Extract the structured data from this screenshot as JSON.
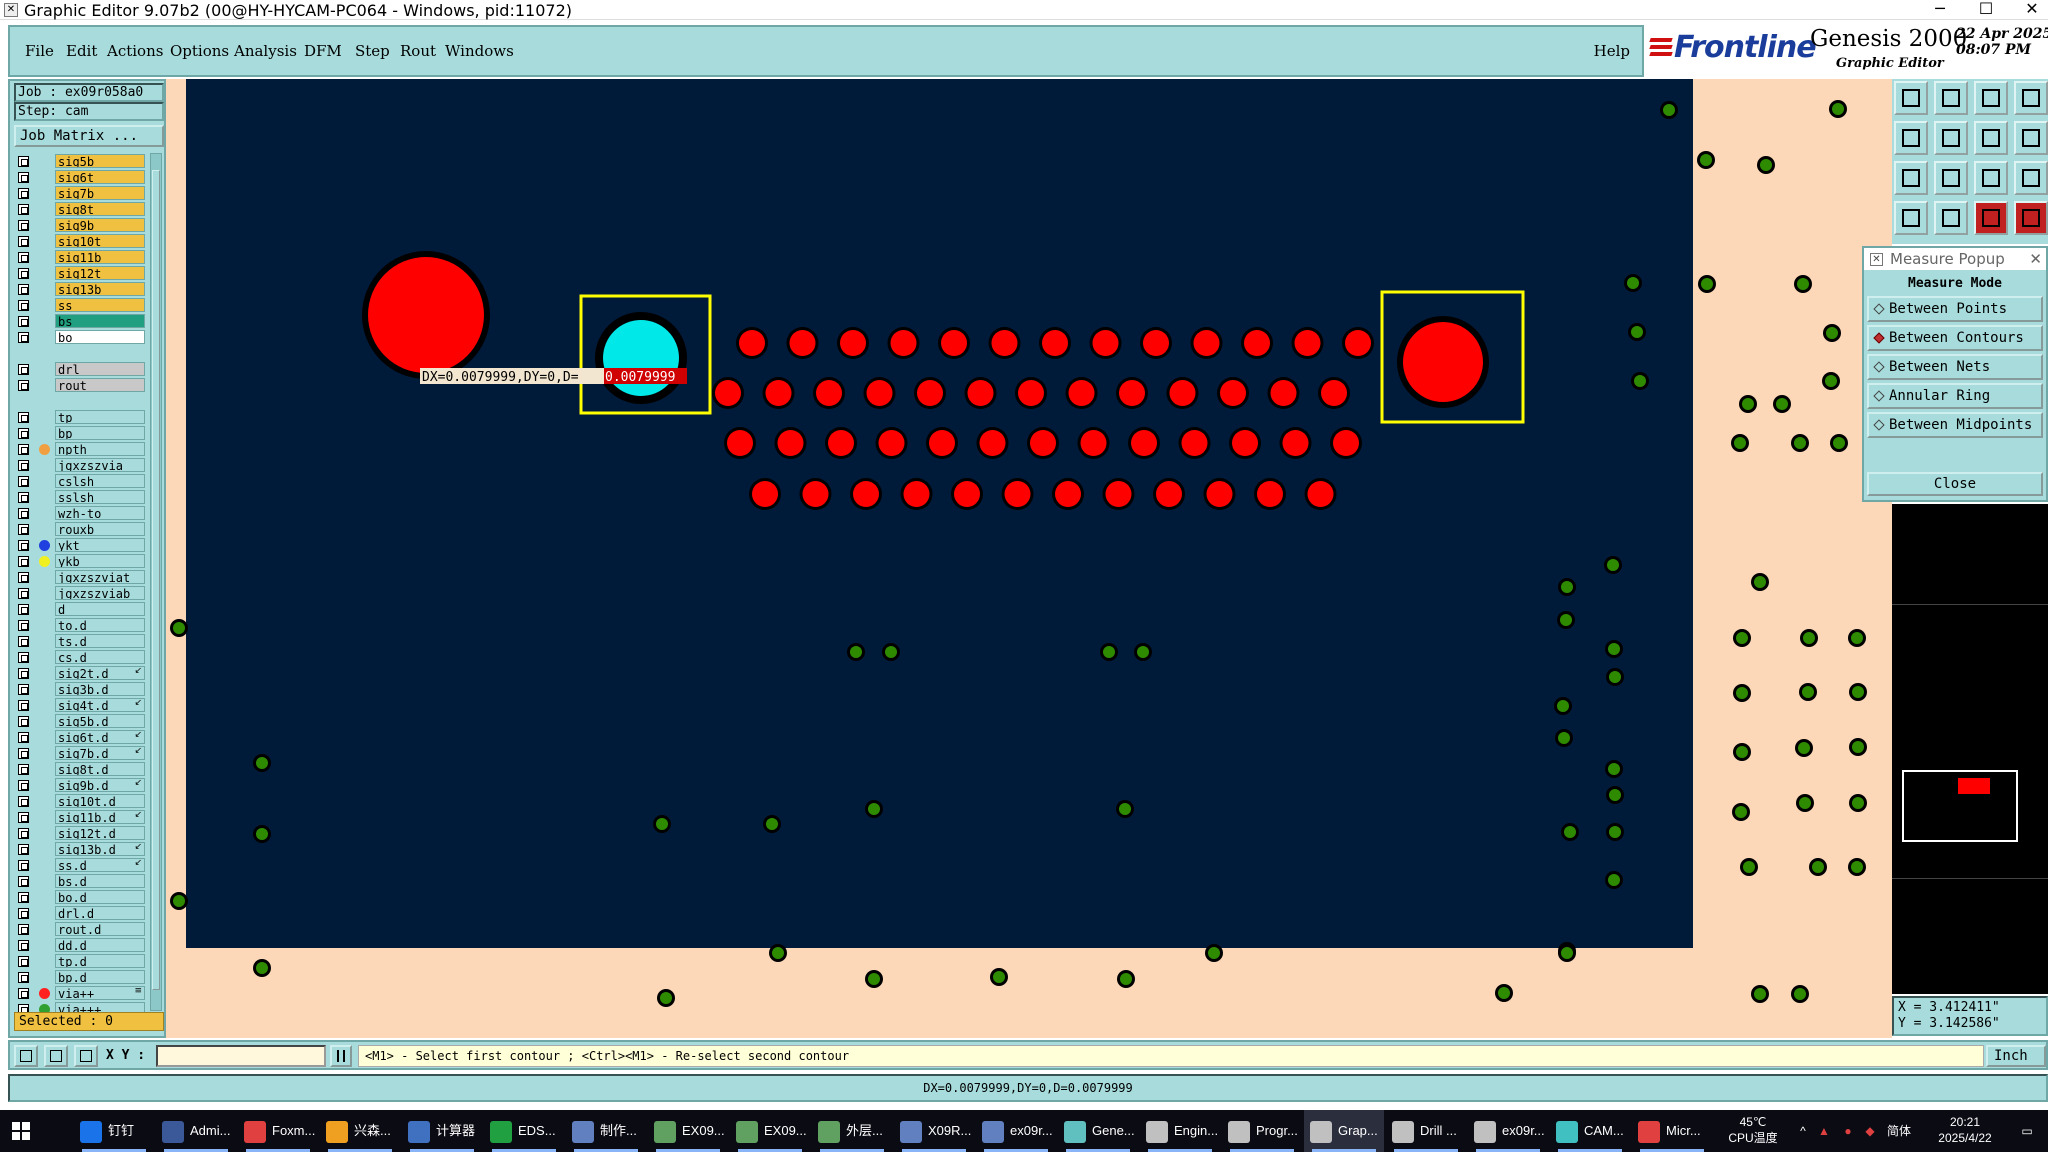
{
  "window": {
    "title": "Graphic Editor 9.07b2 (00@HY-HYCAM-PC064 - Windows, pid:11072)",
    "minimize": "─",
    "maximize": "☐",
    "close": "✕"
  },
  "menubar": {
    "items": [
      "File",
      "Edit",
      "Actions",
      "Options",
      "Analysis",
      "DFM",
      "Step",
      "Rout",
      "Windows"
    ],
    "help": "Help"
  },
  "brand": {
    "logo": "Frontline",
    "product": "Genesis 2000",
    "subtitle": "Graphic Editor",
    "date": "22 Apr 2025",
    "time": "08:07 PM"
  },
  "left": {
    "job": "Job : ex09r058a0",
    "step": "Step: cam",
    "job_matrix": "Job Matrix ...",
    "selected": "Selected : 0",
    "layers": [
      {
        "name": "sig5b",
        "bg": "#f0c040",
        "dot": ""
      },
      {
        "name": "sig6t",
        "bg": "#f0c040",
        "dot": ""
      },
      {
        "name": "sig7b",
        "bg": "#f0c040",
        "dot": ""
      },
      {
        "name": "sig8t",
        "bg": "#f0c040",
        "dot": ""
      },
      {
        "name": "sig9b",
        "bg": "#f0c040",
        "dot": ""
      },
      {
        "name": "sig10t",
        "bg": "#f0c040",
        "dot": ""
      },
      {
        "name": "sig11b",
        "bg": "#f0c040",
        "dot": ""
      },
      {
        "name": "sig12t",
        "bg": "#f0c040",
        "dot": ""
      },
      {
        "name": "sig13b",
        "bg": "#f0c040",
        "dot": ""
      },
      {
        "name": "ss",
        "bg": "#f0c040",
        "dot": ""
      },
      {
        "name": "bs",
        "bg": "#20a080",
        "dot": ""
      },
      {
        "name": "bo",
        "bg": "#ffffff",
        "dot": ""
      },
      {
        "name": "",
        "bg": "",
        "dot": ""
      },
      {
        "name": "drl",
        "bg": "#c8c8c8",
        "dot": ""
      },
      {
        "name": "rout",
        "bg": "#c8c8c8",
        "dot": ""
      },
      {
        "name": "",
        "bg": "",
        "dot": ""
      },
      {
        "name": "tp",
        "bg": "#a8dcdc",
        "dot": ""
      },
      {
        "name": "bp",
        "bg": "#a8dcdc",
        "dot": ""
      },
      {
        "name": "npth",
        "bg": "#a8dcdc",
        "dot": "#f0a040"
      },
      {
        "name": "jgxzszvia",
        "bg": "#a8dcdc",
        "dot": ""
      },
      {
        "name": "cslsh",
        "bg": "#a8dcdc",
        "dot": ""
      },
      {
        "name": "sslsh",
        "bg": "#a8dcdc",
        "dot": ""
      },
      {
        "name": "wzh-to",
        "bg": "#a8dcdc",
        "dot": ""
      },
      {
        "name": "rouxb",
        "bg": "#a8dcdc",
        "dot": ""
      },
      {
        "name": "ykt",
        "bg": "#a8dcdc",
        "dot": "#2040e0"
      },
      {
        "name": "ykb",
        "bg": "#a8dcdc",
        "dot": "#f0f020"
      },
      {
        "name": "jgxzszviat",
        "bg": "#a8dcdc",
        "dot": ""
      },
      {
        "name": "jgxzszviab",
        "bg": "#a8dcdc",
        "dot": ""
      },
      {
        "name": "d",
        "bg": "#a8dcdc",
        "dot": ""
      },
      {
        "name": "to.d",
        "bg": "#a8dcdc",
        "dot": ""
      },
      {
        "name": "ts.d",
        "bg": "#a8dcdc",
        "dot": ""
      },
      {
        "name": "cs.d",
        "bg": "#a8dcdc",
        "dot": ""
      },
      {
        "name": "sig2t.d",
        "bg": "#a8dcdc",
        "dot": "",
        "mark": "↙"
      },
      {
        "name": "sig3b.d",
        "bg": "#a8dcdc",
        "dot": ""
      },
      {
        "name": "sig4t.d",
        "bg": "#a8dcdc",
        "dot": "",
        "mark": "↙"
      },
      {
        "name": "sig5b.d",
        "bg": "#a8dcdc",
        "dot": ""
      },
      {
        "name": "sig6t.d",
        "bg": "#a8dcdc",
        "dot": "",
        "mark": "↙"
      },
      {
        "name": "sig7b.d",
        "bg": "#a8dcdc",
        "dot": "",
        "mark": "↙"
      },
      {
        "name": "sig8t.d",
        "bg": "#a8dcdc",
        "dot": ""
      },
      {
        "name": "sig9b.d",
        "bg": "#a8dcdc",
        "dot": "",
        "mark": "↙"
      },
      {
        "name": "sig10t.d",
        "bg": "#a8dcdc",
        "dot": ""
      },
      {
        "name": "sig11b.d",
        "bg": "#a8dcdc",
        "dot": "",
        "mark": "↙"
      },
      {
        "name": "sig12t.d",
        "bg": "#a8dcdc",
        "dot": ""
      },
      {
        "name": "sig13b.d",
        "bg": "#a8dcdc",
        "dot": "",
        "mark": "↙"
      },
      {
        "name": "ss.d",
        "bg": "#a8dcdc",
        "dot": "",
        "mark": "↙"
      },
      {
        "name": "bs.d",
        "bg": "#a8dcdc",
        "dot": ""
      },
      {
        "name": "bo.d",
        "bg": "#a8dcdc",
        "dot": ""
      },
      {
        "name": "drl.d",
        "bg": "#a8dcdc",
        "dot": ""
      },
      {
        "name": "rout.d",
        "bg": "#a8dcdc",
        "dot": ""
      },
      {
        "name": "dd.d",
        "bg": "#a8dcdc",
        "dot": ""
      },
      {
        "name": "tp.d",
        "bg": "#a8dcdc",
        "dot": ""
      },
      {
        "name": "bp.d",
        "bg": "#a8dcdc",
        "dot": ""
      },
      {
        "name": "via++",
        "bg": "#a8dcdc",
        "dot": "#ff2020",
        "mark": "≡"
      },
      {
        "name": "via+++",
        "bg": "#a8dcdc",
        "dot": "#30a030"
      }
    ]
  },
  "canvas": {
    "measure_label": "DX=0.0079999,DY=0,D=",
    "measure_label_hi": "0.0079999",
    "colors": {
      "board": "#fcd8b8",
      "dark": "#001a3a",
      "pad": "#ff0000",
      "pad_sel": "#00e8e8",
      "via": "#2e8b00",
      "box": "#ffff00"
    }
  },
  "measure": {
    "title": "Measure Popup",
    "mode": "Measure Mode",
    "options": [
      {
        "label": "Between Points",
        "selected": false
      },
      {
        "label": "Between Contours",
        "selected": true
      },
      {
        "label": "Between Nets",
        "selected": false
      },
      {
        "label": "Annular Ring",
        "selected": false
      },
      {
        "label": "Between Midpoints",
        "selected": false
      }
    ],
    "close": "Close"
  },
  "coords": {
    "x": "X = 3.412411\"",
    "y": "Y = 3.142586\""
  },
  "bottom": {
    "xy_label": "X Y :",
    "prompt": "<M1> - Select first contour ; <Ctrl><M1> - Re-select second contour",
    "unit": "Inch"
  },
  "status": "DX=0.0079999,DY=0,D=0.0079999",
  "taskbar": {
    "items": [
      "钉钉",
      "Admi...",
      "Foxm...",
      "兴森...",
      "计算器",
      "EDS...",
      "制作...",
      "EX09...",
      "EX09...",
      "外层...",
      "X09R...",
      "ex09r...",
      "Gene...",
      "Engin...",
      "Progr...",
      "Grap...",
      "Drill ...",
      "ex09r...",
      "CAM...",
      "Micr..."
    ],
    "temp": "45℃",
    "temp_label": "CPU温度",
    "ime": "简体",
    "time": "20:21",
    "date": "2025/4/22"
  }
}
